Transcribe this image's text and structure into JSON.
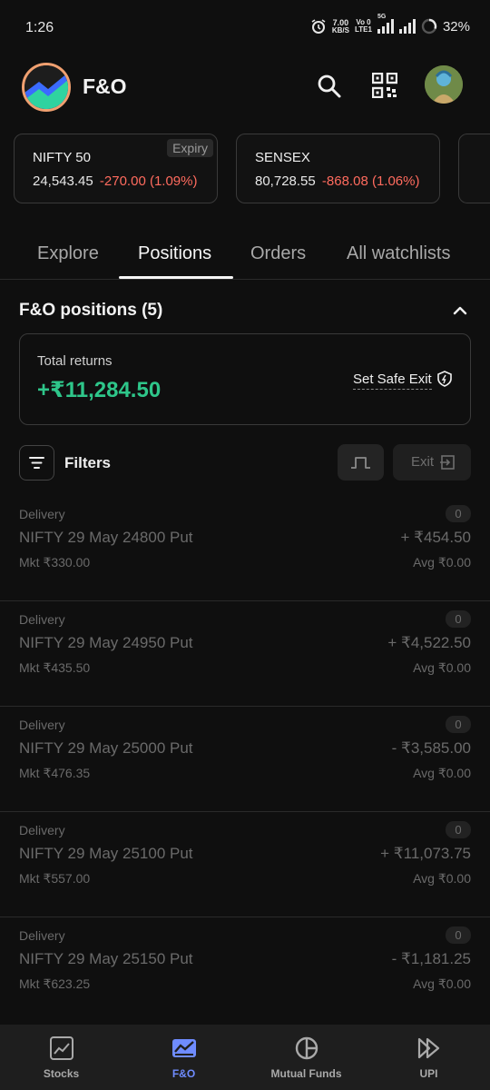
{
  "status_bar": {
    "time": "1:26",
    "speed_value": "7.00",
    "speed_unit": "KB/S",
    "volte_top": "Vo 0",
    "volte_bottom": "LTE1",
    "network": "5G",
    "battery": "32%"
  },
  "header": {
    "title": "F&O",
    "icons": [
      "app-logo",
      "search-icon",
      "qr-code-icon",
      "avatar"
    ]
  },
  "indices": [
    {
      "name": "NIFTY 50",
      "price": "24,543.45",
      "change": "-270.00 (1.09%)",
      "badge": "Expiry"
    },
    {
      "name": "SENSEX",
      "price": "80,728.55",
      "change": "-868.08 (1.06%)"
    }
  ],
  "tabs": [
    {
      "label": "Explore"
    },
    {
      "label": "Positions"
    },
    {
      "label": "Orders"
    },
    {
      "label": "All watchlists"
    }
  ],
  "active_tab": "Positions",
  "positions": {
    "section_title": "F&O positions (5)",
    "total_returns_label": "Total returns",
    "total_returns_value": "+₹11,284.50",
    "safe_exit_label": "Set Safe Exit",
    "filters_label": "Filters",
    "exit_label": "Exit",
    "rows": [
      {
        "type": "Delivery",
        "name": "NIFTY 29 May 24800 Put",
        "mkt": "Mkt ₹330.00",
        "qty": "0",
        "pl": "+ ₹454.50",
        "avg": "Avg ₹0.00"
      },
      {
        "type": "Delivery",
        "name": "NIFTY 29 May 24950 Put",
        "mkt": "Mkt ₹435.50",
        "qty": "0",
        "pl": "+ ₹4,522.50",
        "avg": "Avg ₹0.00"
      },
      {
        "type": "Delivery",
        "name": "NIFTY 29 May 25000 Put",
        "mkt": "Mkt ₹476.35",
        "qty": "0",
        "pl": "- ₹3,585.00",
        "avg": "Avg ₹0.00"
      },
      {
        "type": "Delivery",
        "name": "NIFTY 29 May 25100 Put",
        "mkt": "Mkt ₹557.00",
        "qty": "0",
        "pl": "+ ₹11,073.75",
        "avg": "Avg ₹0.00"
      },
      {
        "type": "Delivery",
        "name": "NIFTY 29 May 25150 Put",
        "mkt": "Mkt ₹623.25",
        "qty": "0",
        "pl": "- ₹1,181.25",
        "avg": "Avg ₹0.00"
      }
    ]
  },
  "bottom_nav": [
    {
      "label": "Stocks",
      "icon": "chart-line-icon"
    },
    {
      "label": "F&O",
      "icon": "fno-icon"
    },
    {
      "label": "Mutual Funds",
      "icon": "pie-icon"
    },
    {
      "label": "UPI",
      "icon": "upi-icon"
    }
  ],
  "colors": {
    "background": "#0f0f0f",
    "positive": "#2ec68a",
    "negative": "#ff6b5e",
    "accent": "#6f8cff"
  }
}
